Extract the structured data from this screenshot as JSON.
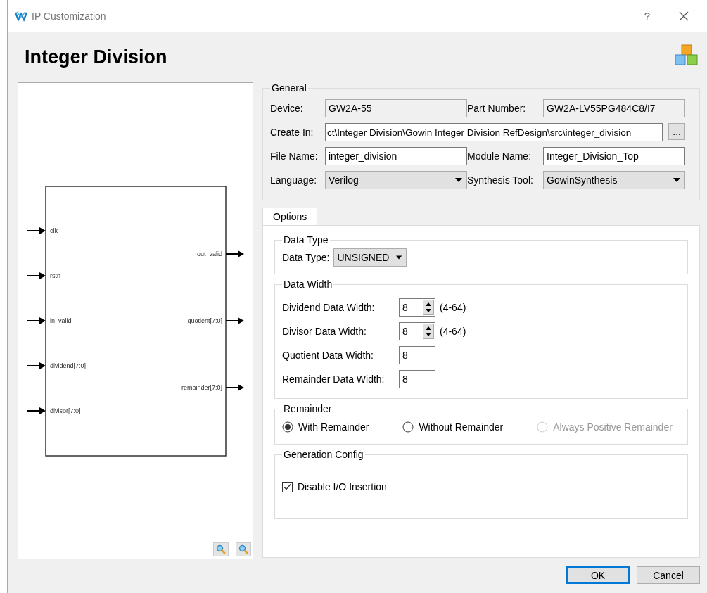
{
  "window": {
    "title": "IP Customization",
    "help": "?"
  },
  "heading": "Integer Division",
  "diagram": {
    "inputs": [
      "clk",
      "rstn",
      "in_valid",
      "dividend[7:0]",
      "divisor[7:0]"
    ],
    "outputs": [
      "out_valid",
      "quotient[7:0]",
      "remainder[7:0]"
    ]
  },
  "general": {
    "title": "General",
    "device": {
      "label": "Device:",
      "value": "GW2A-55"
    },
    "part_number": {
      "label": "Part Number:",
      "value": "GW2A-LV55PG484C8/I7"
    },
    "create_in": {
      "label": "Create In:",
      "value": "ct\\Integer Division\\Gowin Integer Division RefDesign\\src\\integer_division",
      "browse": "..."
    },
    "file_name": {
      "label": "File Name:",
      "value": "integer_division"
    },
    "module_name": {
      "label": "Module Name:",
      "value": "Integer_Division_Top"
    },
    "language": {
      "label": "Language:",
      "value": "Verilog"
    },
    "synthesis_tool": {
      "label": "Synthesis Tool:",
      "value": "GowinSynthesis"
    }
  },
  "tabs": [
    {
      "label": "Options",
      "selected": true
    }
  ],
  "data_type": {
    "title": "Data Type",
    "label": "Data Type:",
    "value": "UNSIGNED"
  },
  "data_width": {
    "title": "Data Width",
    "rows": [
      {
        "kind": "spin",
        "label": "Dividend Data Width:",
        "value": "8",
        "range": "(4-64)"
      },
      {
        "kind": "spin",
        "label": "Divisor Data Width:",
        "value": "8",
        "range": "(4-64)"
      },
      {
        "kind": "text",
        "label": "Quotient Data Width:",
        "value": "8"
      },
      {
        "kind": "text",
        "label": "Remainder Data Width:",
        "value": "8"
      }
    ]
  },
  "remainder": {
    "title": "Remainder",
    "options": [
      {
        "label": "With Remainder",
        "selected": true,
        "disabled": false
      },
      {
        "label": "Without Remainder",
        "selected": false,
        "disabled": false
      },
      {
        "label": "Always Positive Remainder",
        "selected": false,
        "disabled": true
      }
    ]
  },
  "generation_config": {
    "title": "Generation Config",
    "options": [
      {
        "label": "Disable I/O Insertion",
        "checked": true
      }
    ]
  },
  "buttons": [
    {
      "label": "OK",
      "default": true
    },
    {
      "label": "Cancel",
      "default": false
    }
  ]
}
